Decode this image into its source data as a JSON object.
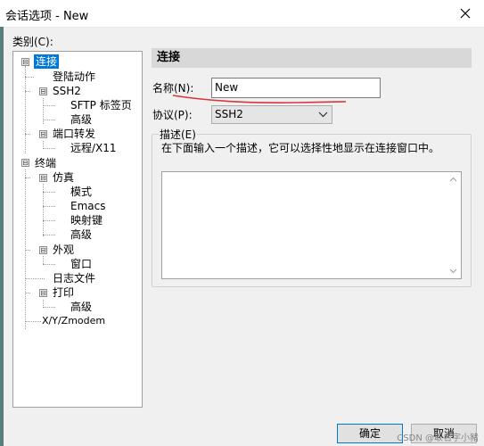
{
  "window": {
    "title": "会话选项 - New",
    "close_icon": "close-icon"
  },
  "category_label": "类别(C):",
  "tree": {
    "nodes": [
      {
        "label": "连接",
        "toggle": "⊟"
      },
      {
        "label": "登陆动作"
      },
      {
        "label": "SSH2",
        "toggle": "⊟"
      },
      {
        "label": "SFTP 标签页"
      },
      {
        "label": "高级"
      },
      {
        "label": "端口转发",
        "toggle": "⊟"
      },
      {
        "label": "远程/X11"
      },
      {
        "label": "终端",
        "toggle": "⊟"
      },
      {
        "label": "仿真",
        "toggle": "⊟"
      },
      {
        "label": "模式"
      },
      {
        "label": "Emacs"
      },
      {
        "label": "映射键"
      },
      {
        "label": "高级"
      },
      {
        "label": "外观",
        "toggle": "⊟"
      },
      {
        "label": "窗口"
      },
      {
        "label": "日志文件"
      },
      {
        "label": "打印",
        "toggle": "⊟"
      },
      {
        "label": "高级"
      },
      {
        "label": "X/Y/Zmodem"
      }
    ],
    "selected": "连接"
  },
  "section": {
    "title": "连接"
  },
  "name": {
    "label": "名称(N):",
    "value": "New"
  },
  "protocol": {
    "label": "协议(P):",
    "value": "SSH2"
  },
  "description": {
    "legend": "描述(E)",
    "hint": "在下面输入一个描述，它可以选择性地显示在连接窗口中。"
  },
  "buttons": {
    "ok": "确定",
    "cancel": "取消"
  },
  "watermark": "CSDN @取名字小豬",
  "colors": {
    "selection": "#0078d7",
    "annotation_line": "#d9363e"
  }
}
